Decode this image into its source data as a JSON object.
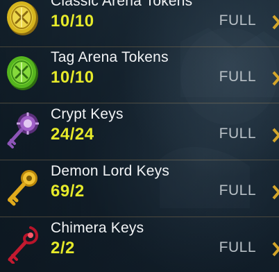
{
  "colors": {
    "count": "#e6ea2a",
    "status": "#b8c0c6",
    "name": "#f2f4f6",
    "divider": "#af8c55",
    "arrow": "#d4a52a"
  },
  "resources": [
    {
      "name": "Classic Arena Tokens",
      "count": "10/10",
      "status": "FULL",
      "icon": "classic-arena-token-icon"
    },
    {
      "name": "Tag Arena Tokens",
      "count": "10/10",
      "status": "FULL",
      "icon": "tag-arena-token-icon"
    },
    {
      "name": "Crypt Keys",
      "count": "24/24",
      "status": "FULL",
      "icon": "crypt-key-icon"
    },
    {
      "name": "Demon Lord Keys",
      "count": "69/2",
      "status": "FULL",
      "icon": "demon-lord-key-icon"
    },
    {
      "name": "Chimera Keys",
      "count": "2/2",
      "status": "FULL",
      "icon": "chimera-key-icon"
    }
  ]
}
